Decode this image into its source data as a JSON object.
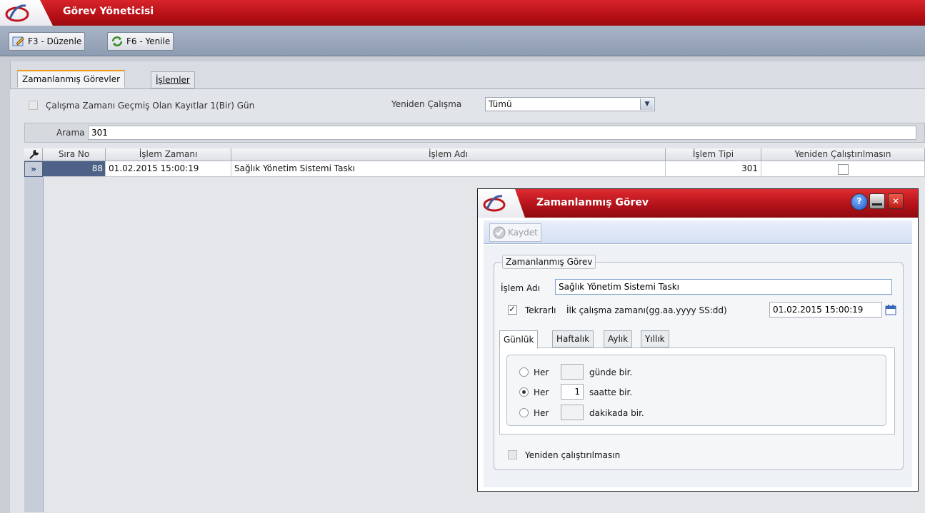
{
  "app": {
    "title": "Görev Yöneticisi"
  },
  "toolbar": {
    "edit_label": "F3 - Düzenle",
    "refresh_label": "F6 - Yenile"
  },
  "tabs": [
    {
      "label": "Zamanlanmış Görevler"
    },
    {
      "label": "İşlemler"
    }
  ],
  "filters": {
    "expired_label": "Çalışma Zamanı Geçmiş Olan Kayıtlar 1(Bir) Gün",
    "rerun_label": "Yeniden Çalışma",
    "rerun_value": "Tümü",
    "search_label": "Arama",
    "search_value": "301"
  },
  "grid": {
    "columns": [
      "Sıra No",
      "İşlem Zamanı",
      "İşlem Adı",
      "İşlem Tipi",
      "Yeniden Çalıştırılmasın"
    ],
    "rows": [
      {
        "sira_no": "88",
        "islem_zamani": "01.02.2015 15:00:19",
        "islem_adi": "Sağlık Yönetim Sistemi Taskı",
        "islem_tipi": "301",
        "yeniden": false
      }
    ],
    "row_marker": "»"
  },
  "dialog": {
    "title": "Zamanlanmış Görev",
    "save_label": "Kaydet",
    "group_label": "Zamanlanmış Görev",
    "name_label": "İşlem Adı",
    "name_value": "Sağlık Yönetim Sistemi Taskı",
    "repeat_label": "Tekrarlı",
    "repeat_checked": true,
    "first_run_label": "İlk çalışma zamanı(gg.aa.yyyy SS:dd)",
    "first_run_value": "01.02.2015 15:00:19",
    "tabs": [
      {
        "label": "Günlük"
      },
      {
        "label": "Haftalık"
      },
      {
        "label": "Aylık"
      },
      {
        "label": "Yıllık"
      }
    ],
    "options": [
      {
        "prefix": "Her",
        "value": "",
        "suffix": "günde bir.",
        "selected": false
      },
      {
        "prefix": "Her",
        "value": "1",
        "suffix": "saatte bir.",
        "selected": true
      },
      {
        "prefix": "Her",
        "value": "",
        "suffix": "dakikada bir.",
        "selected": false
      }
    ],
    "no_rerun_label": "Yeniden çalıştırılmasın"
  },
  "colors": {
    "title_red": "#c0151c",
    "toolbar_blue": "#9aa8bc",
    "focus_blue": "#7da2ce"
  }
}
